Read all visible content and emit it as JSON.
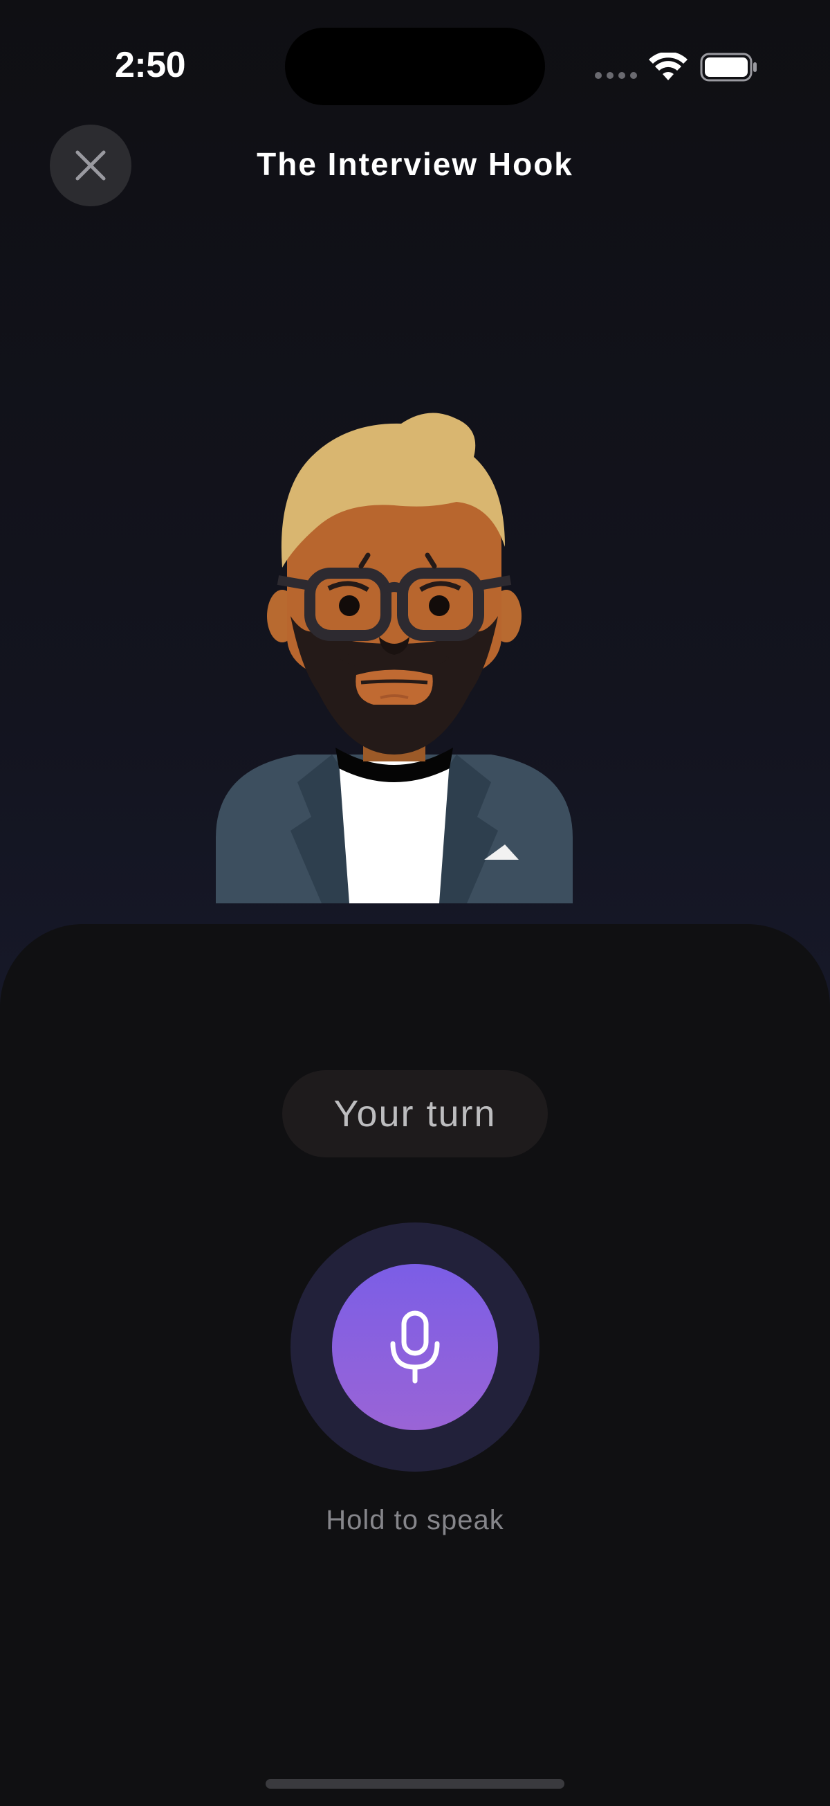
{
  "status_bar": {
    "time": "2:50",
    "icons": [
      "signal-dots-icon",
      "wifi-icon",
      "battery-icon"
    ]
  },
  "header": {
    "title": "The Interview Hook",
    "close_icon": "close-icon"
  },
  "conversation": {
    "turn_label": "Your turn",
    "mic_icon": "microphone-icon",
    "hint": "Hold to speak"
  },
  "colors": {
    "accent_start": "#7b5ee6",
    "accent_end": "#9a64d6",
    "background": "#111114"
  }
}
